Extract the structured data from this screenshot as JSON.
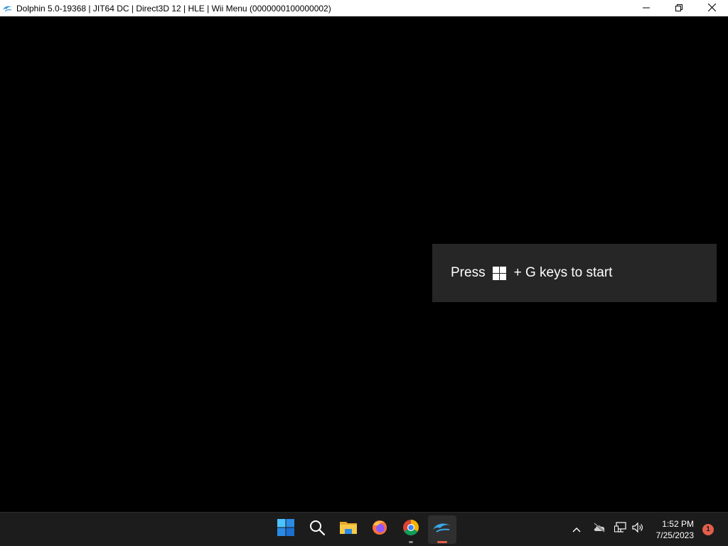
{
  "window": {
    "title": "Dolphin 5.0-19368 | JIT64 DC | Direct3D 12 | HLE | Wii Menu (0000000100000002)",
    "icon": "dolphin-icon",
    "controls": [
      "minimize-icon",
      "restore-icon",
      "close-icon"
    ]
  },
  "toast": {
    "prefix": "Press",
    "suffix": "+ G keys to start",
    "key_icon": "windows-logo-icon"
  },
  "taskbar": {
    "apps": [
      {
        "name": "start",
        "icon": "windows-start-icon"
      },
      {
        "name": "search",
        "icon": "search-icon"
      },
      {
        "name": "file-explorer",
        "icon": "folder-icon"
      },
      {
        "name": "firefox",
        "icon": "firefox-icon"
      },
      {
        "name": "chrome",
        "icon": "chrome-icon"
      },
      {
        "name": "dolphin",
        "icon": "dolphin-icon",
        "active": true
      }
    ],
    "tray": {
      "icons": [
        "chevron-up-icon",
        "onedrive-offline-icon",
        "network-icon",
        "volume-icon"
      ],
      "time": "1:52 PM",
      "date": "7/25/2023",
      "notifications": "1"
    }
  },
  "colors": {
    "accent": "#e35f4c",
    "taskbar_bg": "#1c1c1c",
    "toast_bg": "#262626",
    "start_blue": "#2b8ae6"
  }
}
